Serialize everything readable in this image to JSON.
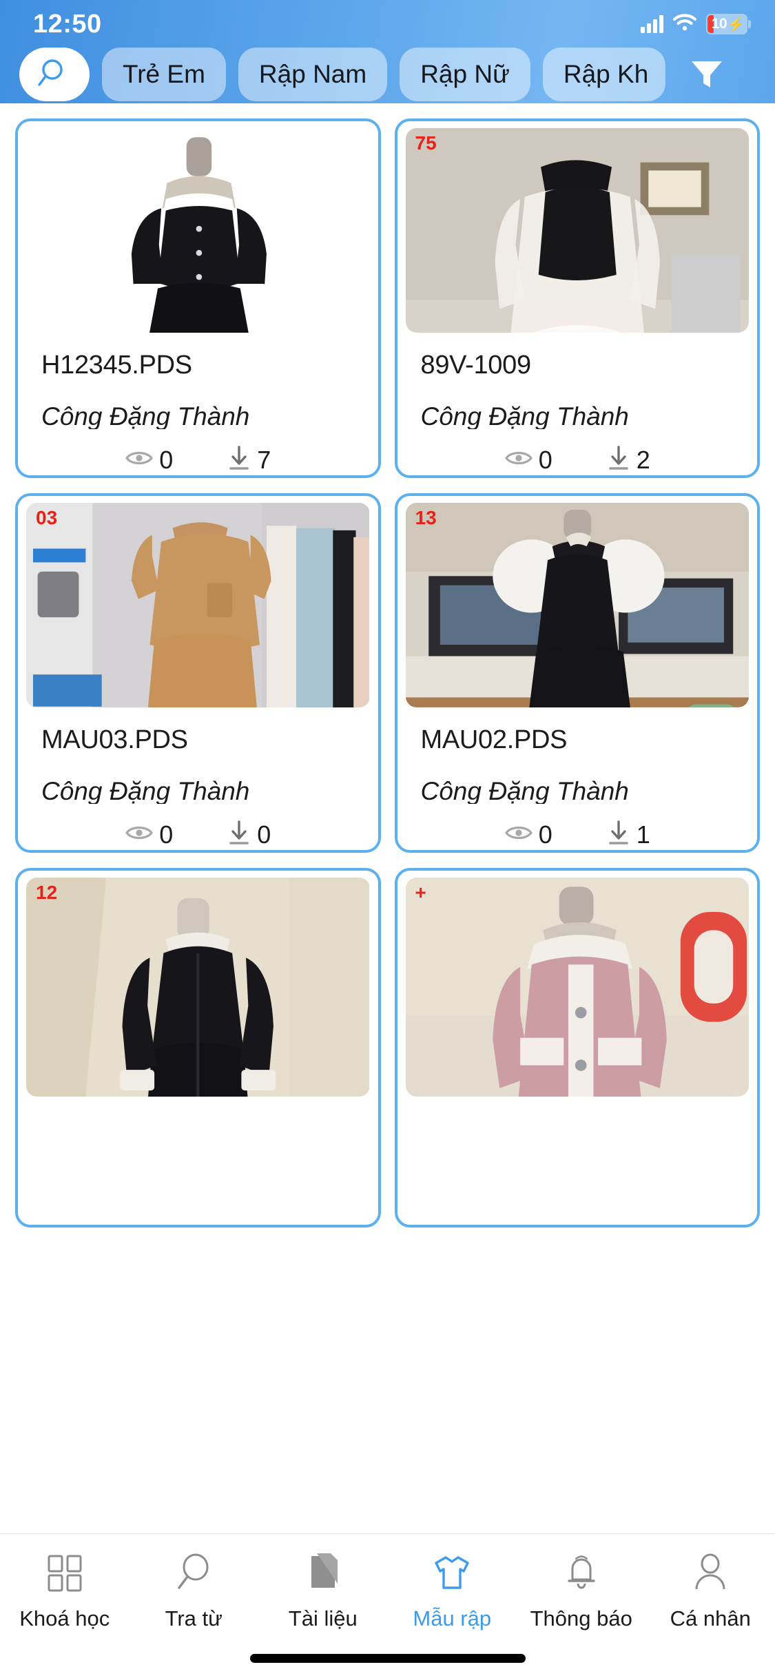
{
  "status_bar": {
    "time": "12:50",
    "battery_level": "10",
    "battery_charging_icon": "bolt-icon",
    "wifi_icon": "wifi-icon",
    "cellular_icon": "cellular-signal-icon"
  },
  "header": {
    "search_icon": "search-icon",
    "filter_icon": "filter-funnel-icon",
    "chips": [
      {
        "label": "Trẻ Em",
        "clipped": false
      },
      {
        "label": "Rập Nam",
        "clipped": false
      },
      {
        "label": "Rập Nữ",
        "clipped": false
      },
      {
        "label": "Rập Kh",
        "clipped": true
      }
    ],
    "accent_color": "#5cb0ee",
    "gradient_from": "#3f8fe0",
    "gradient_to": "#74b6f2"
  },
  "grid": {
    "view_icon": "eye-icon",
    "download_icon": "download-icon",
    "cards": [
      {
        "title": "H12345.PDS",
        "author": "Công Đặng Thành",
        "views": "0",
        "downloads": "7",
        "badge": "",
        "thumb": "black-dress-white-collar-on-mannequin"
      },
      {
        "title": "89V-1009",
        "author": "Công Đặng Thành",
        "views": "0",
        "downloads": "2",
        "badge": "75",
        "thumb": "white-sheer-dress-open-back-on-mannequin"
      },
      {
        "title": "MAU03.PDS",
        "author": "Công Đặng Thành",
        "views": "0",
        "downloads": "0",
        "badge": "03",
        "thumb": "tan-brown-shirt-dress-in-studio"
      },
      {
        "title": "MAU02.PDS",
        "author": "Công Đặng Thành",
        "views": "0",
        "downloads": "1",
        "badge": "13",
        "thumb": "black-dress-with-lace-puff-sleeves"
      },
      {
        "title": "",
        "author": "",
        "views": "",
        "downloads": "",
        "badge": "12",
        "thumb": "black-dress-white-collar-back-view"
      },
      {
        "title": "",
        "author": "",
        "views": "",
        "downloads": "",
        "badge": "+",
        "thumb": "pink-tweed-jacket-dress-on-mannequin"
      }
    ]
  },
  "tabbar": {
    "items": [
      {
        "label": "Khoá học",
        "icon": "grid-squares-icon",
        "active": false
      },
      {
        "label": "Tra từ",
        "icon": "magnifier-icon",
        "active": false
      },
      {
        "label": "Tài liệu",
        "icon": "documents-icon",
        "active": false
      },
      {
        "label": "Mẫu rập",
        "icon": "tshirt-icon",
        "active": true
      },
      {
        "label": "Thông báo",
        "icon": "bell-icon",
        "active": false
      },
      {
        "label": "Cá nhân",
        "icon": "person-icon",
        "active": false
      }
    ],
    "active_color": "#3d9bec",
    "inactive_color": "#1b1b1b"
  }
}
